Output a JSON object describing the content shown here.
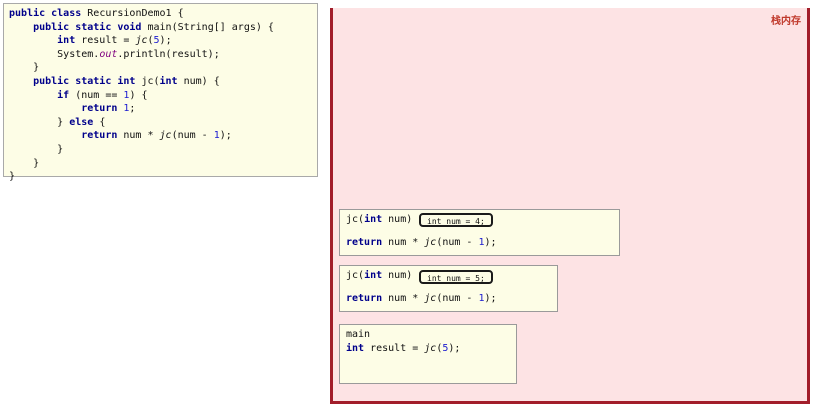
{
  "code_panel": {
    "lines": [
      [
        {
          "t": "public class ",
          "c": "kw"
        },
        {
          "t": "RecursionDemo1 {"
        }
      ],
      [
        {
          "t": "    public static void ",
          "c": "kw"
        },
        {
          "t": "main(String[] args) {"
        }
      ],
      [
        {
          "t": "        int ",
          "c": "kw"
        },
        {
          "t": "result = "
        },
        {
          "t": "jc",
          "c": "it"
        },
        {
          "t": "("
        },
        {
          "t": "5",
          "c": "num"
        },
        {
          "t": ");"
        }
      ],
      [
        {
          "t": "        System."
        },
        {
          "t": "out",
          "c": "out"
        },
        {
          "t": ".println(result);"
        }
      ],
      [
        {
          "t": "    }"
        }
      ],
      [
        {
          "t": "    public static int ",
          "c": "kw"
        },
        {
          "t": "jc("
        },
        {
          "t": "int ",
          "c": "kw"
        },
        {
          "t": "num) {"
        }
      ],
      [
        {
          "t": "        if ",
          "c": "kw"
        },
        {
          "t": "(num == "
        },
        {
          "t": "1",
          "c": "num"
        },
        {
          "t": ") {"
        }
      ],
      [
        {
          "t": "            return ",
          "c": "kw"
        },
        {
          "t": "1",
          "c": "num"
        },
        {
          "t": ";"
        }
      ],
      [
        {
          "t": "        } "
        },
        {
          "t": "else ",
          "c": "kw"
        },
        {
          "t": "{"
        }
      ],
      [
        {
          "t": "            return ",
          "c": "kw"
        },
        {
          "t": "num * "
        },
        {
          "t": "jc",
          "c": "it"
        },
        {
          "t": "(num - "
        },
        {
          "t": "1",
          "c": "num"
        },
        {
          "t": ");"
        }
      ],
      [
        {
          "t": "        }"
        }
      ],
      [
        {
          "t": "    }"
        }
      ],
      [
        {
          "t": "}"
        }
      ]
    ]
  },
  "stack": {
    "title": "栈内存",
    "frames": [
      {
        "id": "frame-jc-4",
        "header": [
          {
            "t": "jc("
          },
          {
            "t": "int ",
            "c": "kw"
          },
          {
            "t": "num)"
          }
        ],
        "var": "int num = 4;",
        "body": [
          {
            "t": "return ",
            "c": "kw"
          },
          {
            "t": "num * "
          },
          {
            "t": "jc",
            "c": "it"
          },
          {
            "t": "(num - "
          },
          {
            "t": "1",
            "c": "num"
          },
          {
            "t": ");"
          }
        ]
      },
      {
        "id": "frame-jc-5",
        "header": [
          {
            "t": "jc("
          },
          {
            "t": "int ",
            "c": "kw"
          },
          {
            "t": "num)"
          }
        ],
        "var": "int num = 5;",
        "body": [
          {
            "t": "return ",
            "c": "kw"
          },
          {
            "t": "num * "
          },
          {
            "t": "jc",
            "c": "it"
          },
          {
            "t": "(num - "
          },
          {
            "t": "1",
            "c": "num"
          },
          {
            "t": ");"
          }
        ]
      },
      {
        "id": "frame-main",
        "header": [
          {
            "t": "main"
          }
        ],
        "var": "",
        "body": [
          {
            "t": "int ",
            "c": "kw"
          },
          {
            "t": "result = "
          },
          {
            "t": "jc",
            "c": "it"
          },
          {
            "t": "("
          },
          {
            "t": "5",
            "c": "num"
          },
          {
            "t": ");"
          }
        ]
      }
    ]
  },
  "colors": {
    "keyword": "#00008b",
    "number": "#1b1bd0",
    "static_field": "#7f007f",
    "stack_bg": "#fde3e4",
    "stack_border": "#a21d2a",
    "code_bg": "#fdfde6"
  }
}
